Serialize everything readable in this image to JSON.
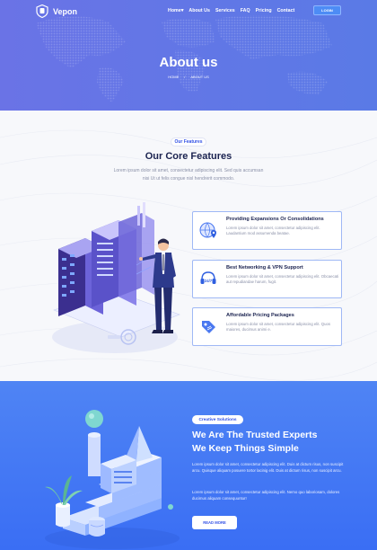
{
  "header": {
    "logo_text": "Vepon",
    "menu": [
      "Home▾",
      "About Us",
      "Services",
      "FAQ",
      "Pricing",
      "Contact"
    ],
    "login_label": "LOGIN"
  },
  "hero": {
    "title": "About us",
    "breadcrumb": [
      "HOME",
      "/",
      "ABOUT US"
    ]
  },
  "features": {
    "badge": "Our Features",
    "title": "Our Core Features",
    "description": "Lorem ipsum dolor sit amet, consectetur adipiscing elit. Sed quis accumsan nisi Ut ut felis congue nisl hendrerit commodo.",
    "cards": [
      {
        "icon": "globe-location-icon",
        "title": "Providing Expansions Or Consolidations",
        "text": "Lorem ipsum dolor sit amet, consectetur adipiscing elit. Laudantium mod assumenda beatae."
      },
      {
        "icon": "headset-24-7-icon",
        "title": "Best Networking & VPN Support",
        "text": "Lorem ipsum dolor sit amet, consectetur adipiscing elit. Obcaecati aut repudiandae harum, fugit."
      },
      {
        "icon": "price-tag-icon",
        "title": "Affordable Pricing Packages",
        "text": "Lorem ipsum dolor sit amet, consectetur adipiscing elit. Quos maiores, ducimus animi e."
      }
    ]
  },
  "trusted": {
    "badge": "Creative Solutions",
    "title_line1": "We Are The Trusted Experts",
    "title_line2": "We Keep Things Simple",
    "para1": "Lorem ipsum dolor sit amet, consectetur adipiscing elit. Duis at dictum risus, non suscipit arcu. Quisque aliquam posuere tortor lacinig elit. Duis at dictum risus, non suscipit arcu.",
    "para2": "Lorem ipsum dolor sit amet, consectetur adipiscing elit. Nemo quo laboriosam, dolores ducimus aliquam consequuntur!",
    "button_label": "READ MORE"
  },
  "colors": {
    "hero_bg": "#6a73e6",
    "accent": "#3352e6",
    "heading": "#1b2350",
    "trusted_bg": "#4f84f4"
  }
}
